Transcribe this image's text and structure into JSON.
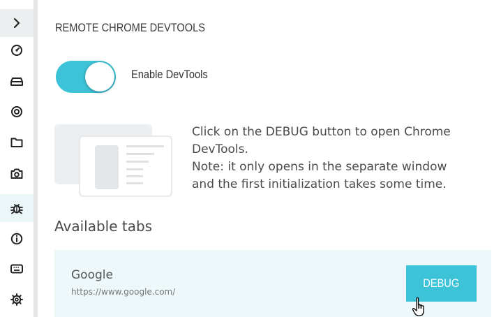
{
  "sidebar": {
    "items": [
      {
        "icon": "chevron-right-icon"
      },
      {
        "icon": "speedometer-icon"
      },
      {
        "icon": "storage-drive-icon"
      },
      {
        "icon": "location-target-icon"
      },
      {
        "icon": "folder-icon"
      },
      {
        "icon": "camera-icon"
      },
      {
        "icon": "bug-icon",
        "active": true
      },
      {
        "icon": "info-icon"
      },
      {
        "icon": "keyboard-icon"
      },
      {
        "icon": "settings-gear-icon"
      }
    ]
  },
  "main": {
    "title": "REMOTE CHROME DEVTOOLS",
    "toggle": {
      "label": "Enable DevTools",
      "on": true
    },
    "description_lines": [
      "Click on the DEBUG button to open Chrome",
      "DevTools.",
      "Note: it only opens in the separate window",
      "and the first initialization takes some time."
    ],
    "available_tabs_heading": "Available tabs",
    "tabs": [
      {
        "name": "Google",
        "url": "https://www.google.com/",
        "button_label": "DEBUG"
      }
    ]
  },
  "colors": {
    "accent": "#3cc3d7",
    "card_bg": "#eef8fa",
    "sidebar_divider": "#e3e5e6"
  }
}
